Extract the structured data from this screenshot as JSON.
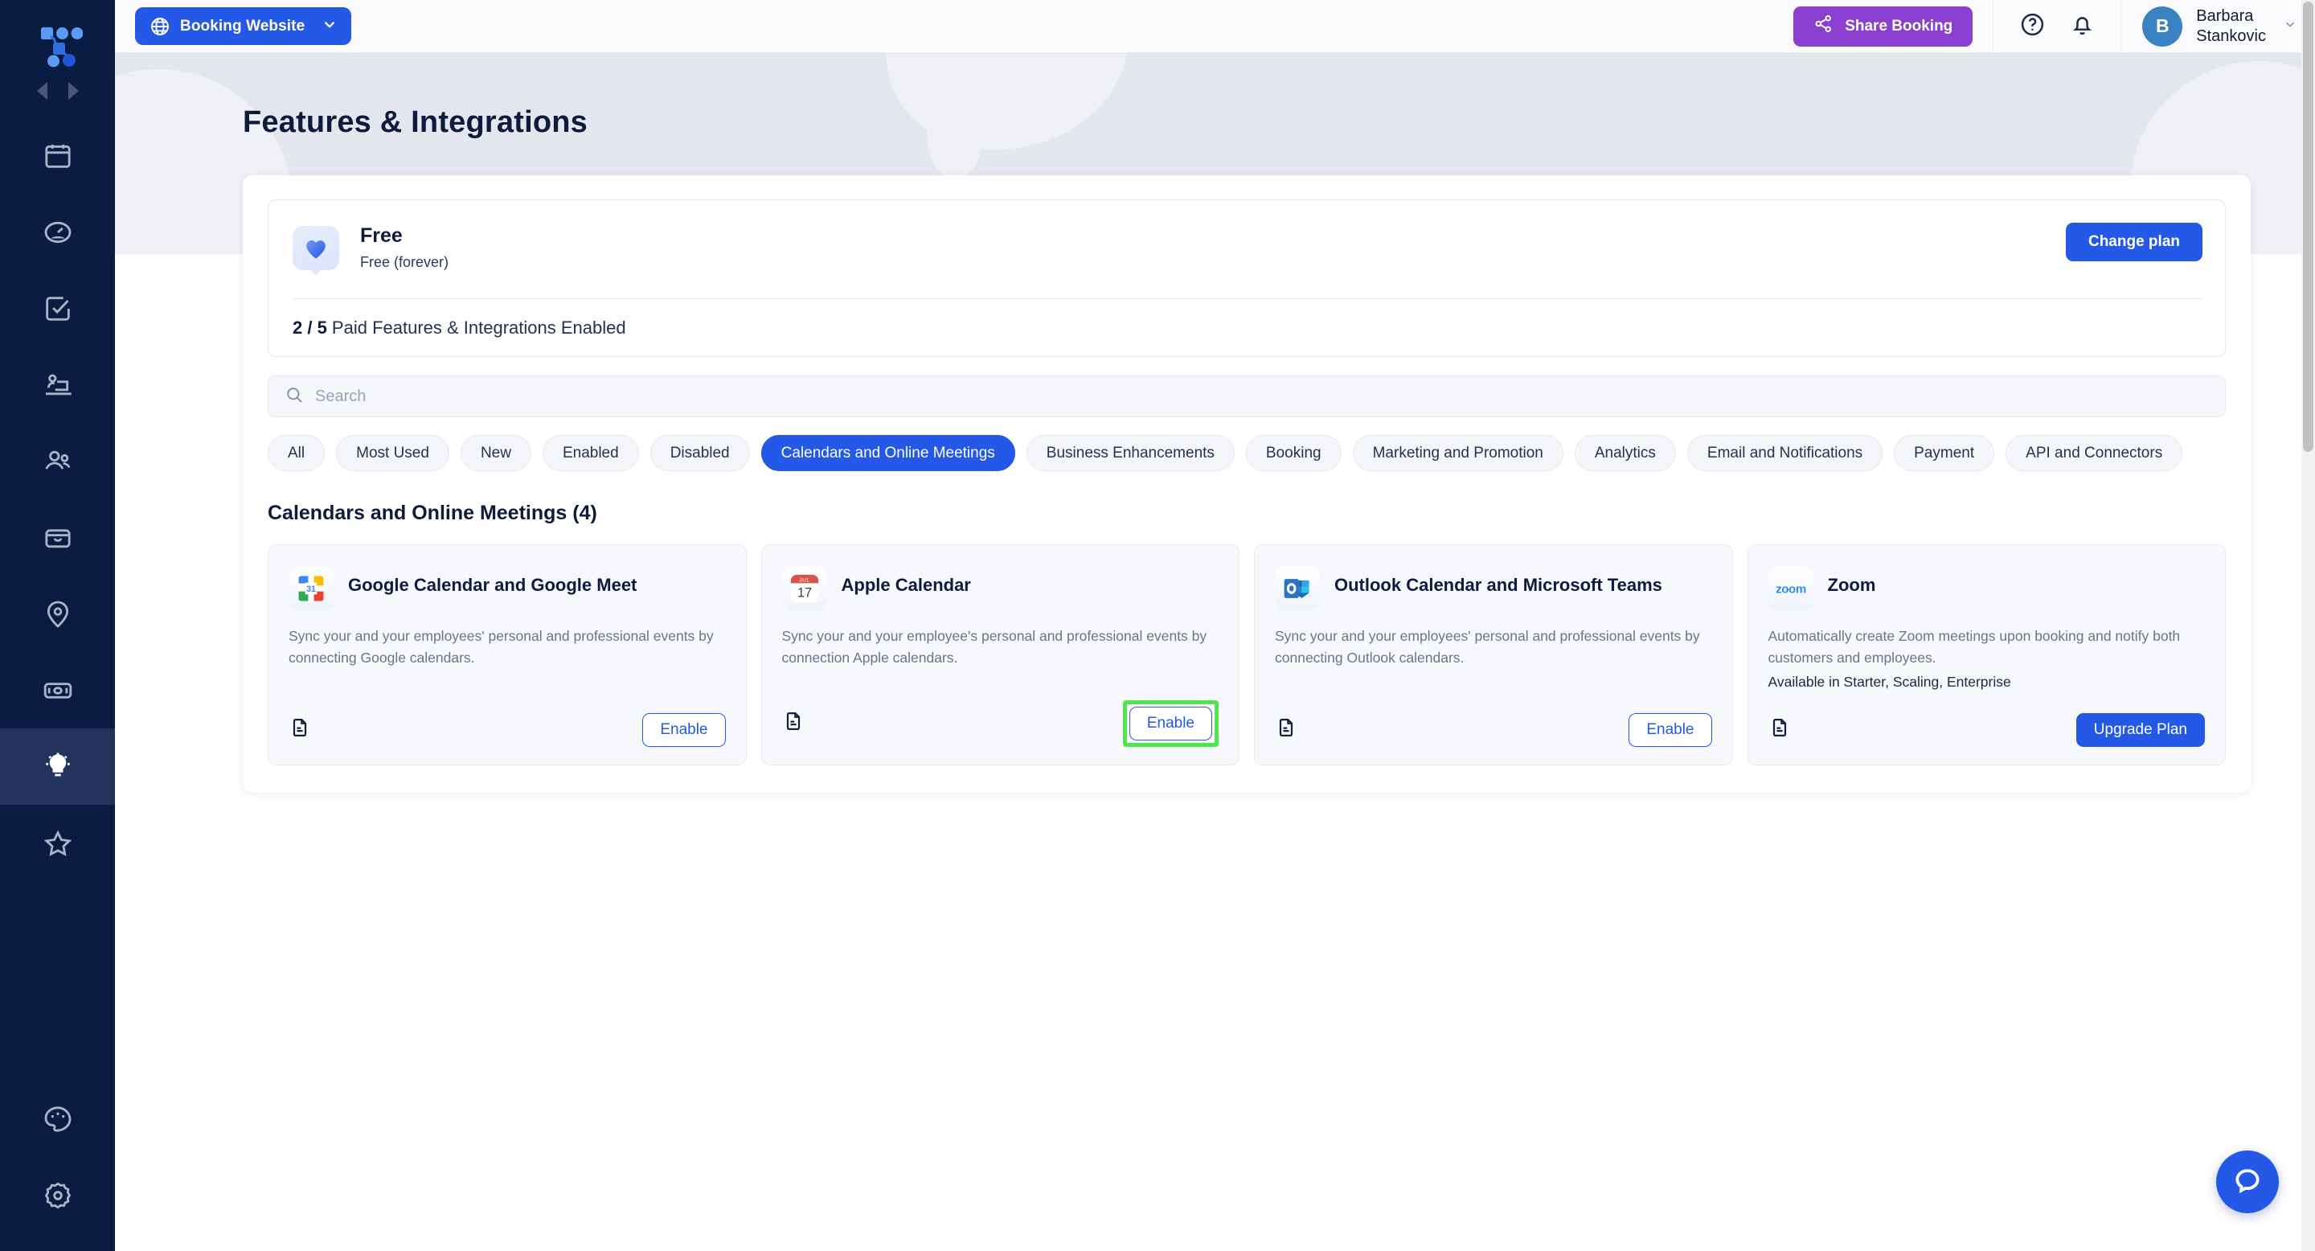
{
  "sidebar": {
    "logo_name": "logo-icon",
    "collapse_prev_label": "Collapse",
    "collapse_next_label": "Expand",
    "items": [
      {
        "key": "calendar",
        "icon": "calendar-icon",
        "active": false
      },
      {
        "key": "dashboard",
        "icon": "speedometer-icon",
        "active": false
      },
      {
        "key": "tasks",
        "icon": "checkbox-icon",
        "active": false
      },
      {
        "key": "workspace",
        "icon": "person-laptop-icon",
        "active": false
      },
      {
        "key": "customers",
        "icon": "people-icon",
        "active": false
      },
      {
        "key": "inbox",
        "icon": "inbox-icon",
        "active": false
      },
      {
        "key": "locations",
        "icon": "location-pin-icon",
        "active": false
      },
      {
        "key": "payments",
        "icon": "money-icon",
        "active": false
      },
      {
        "key": "features",
        "icon": "lightbulb-icon",
        "active": true
      },
      {
        "key": "favorites",
        "icon": "star-icon",
        "active": false
      },
      {
        "key": "appearance",
        "icon": "palette-icon",
        "active": false
      },
      {
        "key": "settings",
        "icon": "gear-icon",
        "active": false
      }
    ]
  },
  "topbar": {
    "booking_website_label": "Booking Website",
    "booking_website_icon": "globe-icon",
    "booking_website_caret": "chevron-down-icon",
    "share_booking_label": "Share Booking",
    "share_icon": "share-nodes-icon",
    "help_icon": "question-circle-icon",
    "notifications_icon": "bell-icon",
    "user": {
      "avatar_initial": "B",
      "first_name": "Barbara",
      "last_name": "Stankovic",
      "caret": "chevron-down-icon"
    }
  },
  "page": {
    "title": "Features & Integrations"
  },
  "plan": {
    "icon": "heart-bubble-icon",
    "name": "Free",
    "billing": "Free (forever)",
    "change_plan_label": "Change plan",
    "counter_value": "2 / 5",
    "counter_text": " Paid Features & Integrations Enabled"
  },
  "search": {
    "placeholder": "Search",
    "value": "",
    "icon": "search-icon"
  },
  "filters": {
    "chips": [
      {
        "label": "All",
        "active": false
      },
      {
        "label": "Most Used",
        "active": false
      },
      {
        "label": "New",
        "active": false
      },
      {
        "label": "Enabled",
        "active": false
      },
      {
        "label": "Disabled",
        "active": false
      },
      {
        "label": "Calendars and Online Meetings",
        "active": true
      },
      {
        "label": "Business Enhancements",
        "active": false
      },
      {
        "label": "Booking",
        "active": false
      },
      {
        "label": "Marketing and Promotion",
        "active": false
      },
      {
        "label": "Analytics",
        "active": false
      },
      {
        "label": "Email and Notifications",
        "active": false
      },
      {
        "label": "Payment",
        "active": false
      },
      {
        "label": "API and Connectors",
        "active": false
      }
    ]
  },
  "section": {
    "title": "Calendars and Online Meetings (4)",
    "cards": [
      {
        "logo": "google-calendar-icon",
        "name": "Google Calendar and Google Meet",
        "description": "Sync your and your employees' personal and professional events by connecting Google calendars.",
        "availability": "",
        "doc_icon": "document-icon",
        "action_label": "Enable",
        "action_style": "outline",
        "highlighted": false
      },
      {
        "logo": "apple-calendar-icon",
        "name": "Apple Calendar",
        "description": "Sync your and your employee's personal and professional events by connection Apple calendars.",
        "availability": "",
        "doc_icon": "document-icon",
        "action_label": "Enable",
        "action_style": "outline",
        "highlighted": true
      },
      {
        "logo": "outlook-icon",
        "name": "Outlook Calendar and Microsoft Teams",
        "description": "Sync your and your employees' personal and professional events by connecting Outlook calendars.",
        "availability": "",
        "doc_icon": "document-icon",
        "action_label": "Enable",
        "action_style": "outline",
        "highlighted": false
      },
      {
        "logo": "zoom-icon",
        "name": "Zoom",
        "description": "Automatically create Zoom meetings upon booking and notify both customers and employees.",
        "availability": "Available in Starter, Scaling, Enterprise",
        "doc_icon": "document-icon",
        "action_label": "Upgrade Plan",
        "action_style": "filled",
        "highlighted": false
      }
    ]
  },
  "chat": {
    "icon": "chat-bubble-icon"
  },
  "colors": {
    "brand_blue": "#2458e6",
    "share_purple": "#8a3fd1",
    "sidebar_navy": "#0b1c42",
    "highlight_green": "#4ee54e",
    "avatar_blue": "#3b82c4"
  }
}
